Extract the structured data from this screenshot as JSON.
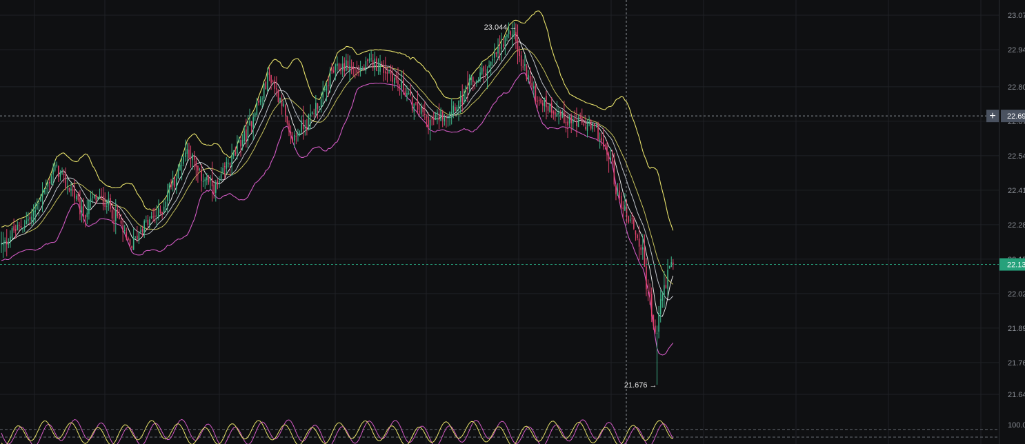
{
  "chart_data": {
    "type": "candlestick",
    "title": "",
    "xlabel": "",
    "ylabel": "",
    "ylim": [
      21.62,
      23.075
    ],
    "y_ticks": [
      "23.07",
      "22.94",
      "22.80",
      "22.67",
      "22.54",
      "22.41",
      "22.28",
      "22.15",
      "22.02",
      "21.89",
      "21.76",
      "21.64"
    ],
    "y_tick_values": [
      23.07,
      22.94,
      22.8,
      22.67,
      22.54,
      22.41,
      22.28,
      22.15,
      22.02,
      21.89,
      21.76,
      21.64
    ],
    "max_annotation": "23.044",
    "min_annotation": "21.676",
    "max_value": 23.044,
    "min_value": 21.676,
    "crosshair_price": "22.69",
    "crosshair_value": 22.69,
    "last_price": "22.13",
    "last_value": 22.13,
    "oscillator_level": "100.0",
    "oscillator_level_value": 100.0,
    "key_levels": [
      {
        "i": 0,
        "v": 22.2
      },
      {
        "i": 8,
        "v": 22.26
      },
      {
        "i": 16,
        "v": 22.3
      },
      {
        "i": 24,
        "v": 22.41
      },
      {
        "i": 30,
        "v": 22.49
      },
      {
        "i": 38,
        "v": 22.42
      },
      {
        "i": 46,
        "v": 22.32
      },
      {
        "i": 52,
        "v": 22.38
      },
      {
        "i": 58,
        "v": 22.37
      },
      {
        "i": 64,
        "v": 22.31
      },
      {
        "i": 72,
        "v": 22.2
      },
      {
        "i": 80,
        "v": 22.28
      },
      {
        "i": 88,
        "v": 22.32
      },
      {
        "i": 96,
        "v": 22.44
      },
      {
        "i": 104,
        "v": 22.56
      },
      {
        "i": 112,
        "v": 22.46
      },
      {
        "i": 120,
        "v": 22.42
      },
      {
        "i": 128,
        "v": 22.52
      },
      {
        "i": 136,
        "v": 22.61
      },
      {
        "i": 144,
        "v": 22.74
      },
      {
        "i": 150,
        "v": 22.84
      },
      {
        "i": 156,
        "v": 22.76
      },
      {
        "i": 162,
        "v": 22.6
      },
      {
        "i": 170,
        "v": 22.66
      },
      {
        "i": 178,
        "v": 22.74
      },
      {
        "i": 186,
        "v": 22.86
      },
      {
        "i": 192,
        "v": 22.88
      },
      {
        "i": 200,
        "v": 22.86
      },
      {
        "i": 208,
        "v": 22.89
      },
      {
        "i": 216,
        "v": 22.86
      },
      {
        "i": 224,
        "v": 22.8
      },
      {
        "i": 232,
        "v": 22.72
      },
      {
        "i": 240,
        "v": 22.67
      },
      {
        "i": 248,
        "v": 22.7
      },
      {
        "i": 256,
        "v": 22.74
      },
      {
        "i": 264,
        "v": 22.82
      },
      {
        "i": 272,
        "v": 22.87
      },
      {
        "i": 280,
        "v": 22.95
      },
      {
        "i": 286,
        "v": 23.01
      },
      {
        "i": 292,
        "v": 22.87
      },
      {
        "i": 300,
        "v": 22.76
      },
      {
        "i": 308,
        "v": 22.72
      },
      {
        "i": 316,
        "v": 22.68
      },
      {
        "i": 324,
        "v": 22.66
      },
      {
        "i": 332,
        "v": 22.64
      },
      {
        "i": 340,
        "v": 22.54
      },
      {
        "i": 346,
        "v": 22.37
      },
      {
        "i": 352,
        "v": 22.3
      },
      {
        "i": 358,
        "v": 22.2
      },
      {
        "i": 362,
        "v": 22.03
      },
      {
        "i": 366,
        "v": 21.86
      },
      {
        "i": 370,
        "v": 22.02
      },
      {
        "i": 374,
        "v": 22.11
      },
      {
        "i": 376,
        "v": 22.13
      }
    ],
    "colors": {
      "background": "#0f1012",
      "grid": "#1f2125",
      "up": "#3fb68b",
      "down": "#e0426b",
      "band_upper": "#e9e36b",
      "band_lower": "#d45bc6",
      "ma_fast": "#ffffff",
      "ma_slow": "#c0c4cc",
      "ma_mid": "#e9e36b",
      "crosshair": "#8b8f96",
      "last_price_tag": "#26a17b",
      "crosshair_tag": "#4a5260",
      "axis_text": "#8b8f96"
    }
  }
}
